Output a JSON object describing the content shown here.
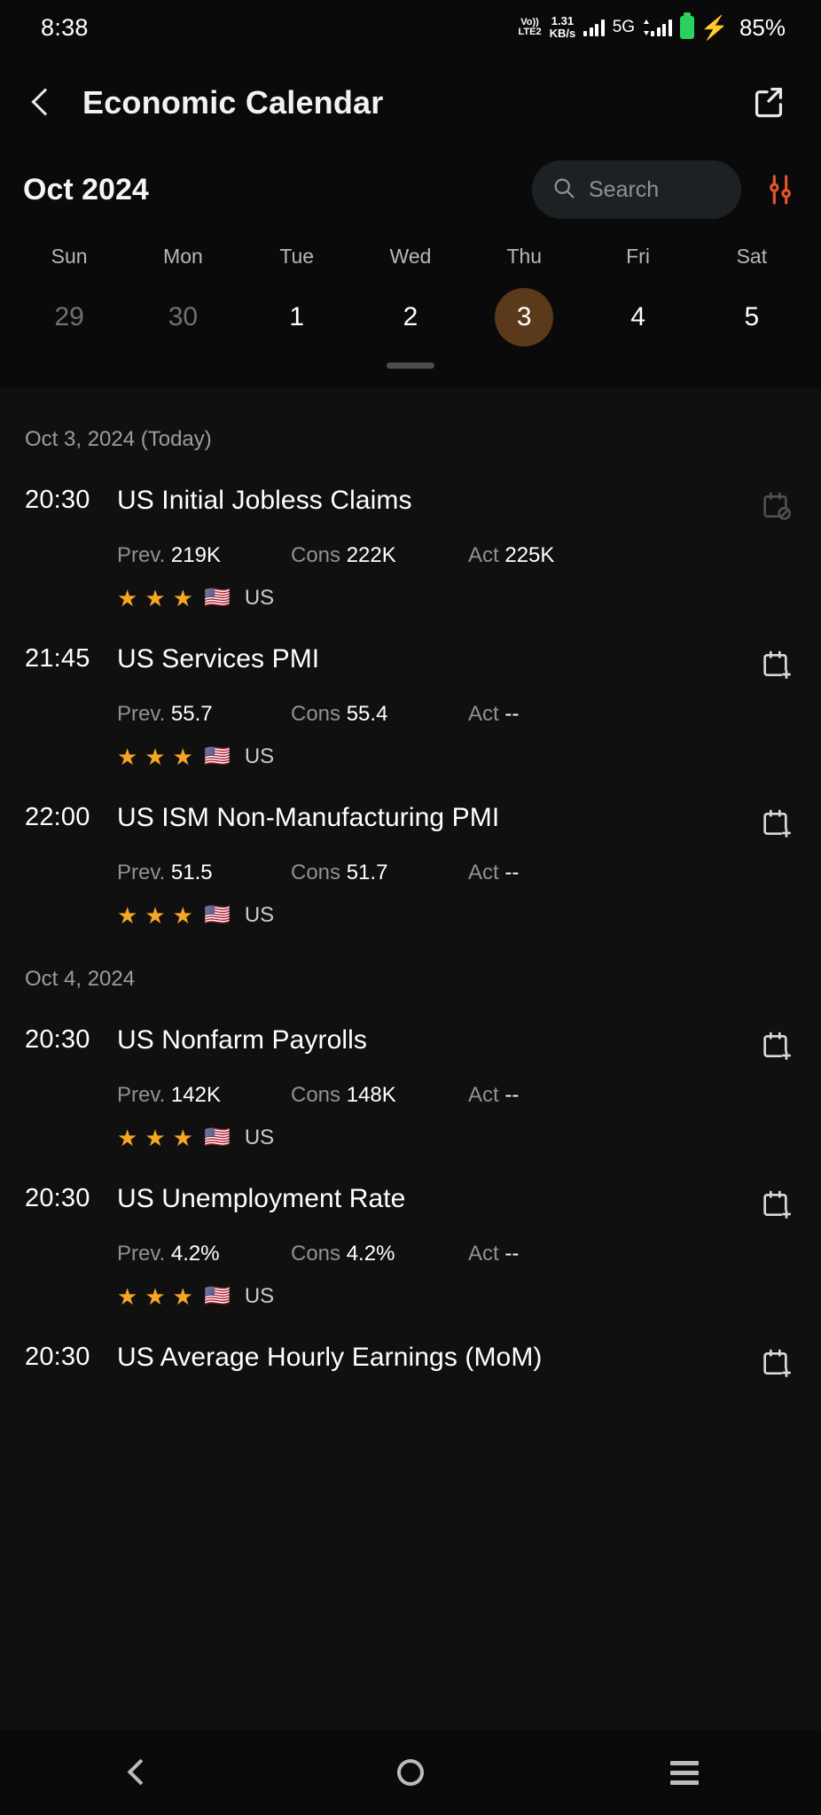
{
  "status_bar": {
    "time": "8:38",
    "volte_line1": "Vo))",
    "volte_line2": "LTE2",
    "netspeed_value": "1.31",
    "netspeed_unit": "KB/s",
    "network_type": "5G",
    "battery_percent": "85%",
    "battery_color": "#2bd15e",
    "charging_bolt_color": "#ffc107"
  },
  "app_bar": {
    "title": "Economic Calendar",
    "back_icon": "back-chevron-icon",
    "share_icon": "share-icon"
  },
  "calendar": {
    "month_label": "Oct 2024",
    "search": {
      "placeholder": "Search",
      "value": "",
      "icon": "search-icon"
    },
    "filter_icon": "filter-sliders-icon",
    "filter_color": "#e2562a",
    "weekday_headers": [
      "Sun",
      "Mon",
      "Tue",
      "Wed",
      "Thu",
      "Fri",
      "Sat"
    ],
    "dates": [
      {
        "label": "29",
        "muted": true,
        "selected": false
      },
      {
        "label": "30",
        "muted": true,
        "selected": false
      },
      {
        "label": "1",
        "muted": false,
        "selected": false
      },
      {
        "label": "2",
        "muted": false,
        "selected": false
      },
      {
        "label": "3",
        "muted": false,
        "selected": true
      },
      {
        "label": "4",
        "muted": false,
        "selected": false
      },
      {
        "label": "5",
        "muted": false,
        "selected": false
      }
    ],
    "selected_highlight_color": "#5b3a1b"
  },
  "sections": [
    {
      "header": "Oct 3, 2024 (Today)",
      "events": [
        {
          "time": "20:30",
          "title": "US Initial Jobless Claims",
          "prev_label": "Prev.",
          "prev_value": "219K",
          "cons_label": "Cons",
          "cons_value": "222K",
          "act_label": "Act",
          "act_value": "225K",
          "importance": 3,
          "flag": "🇺🇸",
          "country": "US",
          "calendar_icon": "calendar-blocked-icon"
        },
        {
          "time": "21:45",
          "title": "US Services PMI",
          "prev_label": "Prev.",
          "prev_value": "55.7",
          "cons_label": "Cons",
          "cons_value": "55.4",
          "act_label": "Act",
          "act_value": "--",
          "importance": 3,
          "flag": "🇺🇸",
          "country": "US",
          "calendar_icon": "calendar-add-icon"
        },
        {
          "time": "22:00",
          "title": "US ISM Non-Manufacturing PMI",
          "prev_label": "Prev.",
          "prev_value": "51.5",
          "cons_label": "Cons",
          "cons_value": "51.7",
          "act_label": "Act",
          "act_value": "--",
          "importance": 3,
          "flag": "🇺🇸",
          "country": "US",
          "calendar_icon": "calendar-add-icon"
        }
      ]
    },
    {
      "header": "Oct 4, 2024",
      "events": [
        {
          "time": "20:30",
          "title": "US Nonfarm Payrolls",
          "prev_label": "Prev.",
          "prev_value": "142K",
          "cons_label": "Cons",
          "cons_value": "148K",
          "act_label": "Act",
          "act_value": "--",
          "importance": 3,
          "flag": "🇺🇸",
          "country": "US",
          "calendar_icon": "calendar-add-icon"
        },
        {
          "time": "20:30",
          "title": "US Unemployment Rate",
          "prev_label": "Prev.",
          "prev_value": "4.2%",
          "cons_label": "Cons",
          "cons_value": "4.2%",
          "act_label": "Act",
          "act_value": "--",
          "importance": 3,
          "flag": "🇺🇸",
          "country": "US",
          "calendar_icon": "calendar-add-icon"
        },
        {
          "time": "20:30",
          "title": "US Average Hourly Earnings (MoM)",
          "prev_label": "",
          "prev_value": "",
          "cons_label": "",
          "cons_value": "",
          "act_label": "",
          "act_value": "",
          "importance": 0,
          "flag": "",
          "country": "",
          "calendar_icon": "calendar-add-icon",
          "truncated": true
        }
      ]
    }
  ],
  "nav_bar": {
    "back_icon": "nav-back-icon",
    "home_icon": "nav-home-icon",
    "recents_icon": "nav-recents-icon"
  },
  "theme": {
    "background": "#0a0a0a",
    "list_background": "#101010",
    "star_color": "#f5a623",
    "accent": "#e2562a"
  }
}
